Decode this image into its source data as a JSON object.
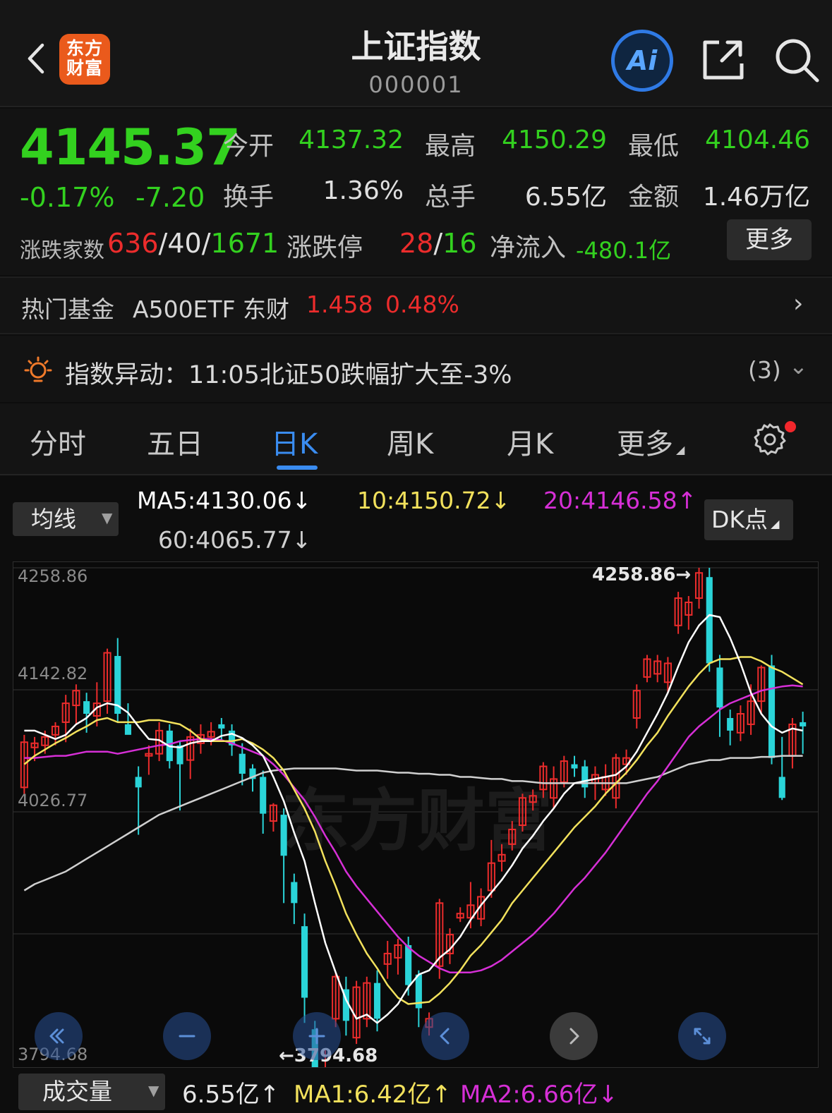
{
  "header": {
    "logo_line1": "东方",
    "logo_line2": "财富",
    "title": "上证指数",
    "code": "000001",
    "ai_label": "Ai",
    "icons": [
      "back-icon",
      "ai-icon",
      "share-icon",
      "search-icon"
    ]
  },
  "quote": {
    "price": "4145.37",
    "change_pct": "-0.17%",
    "change_val": "-7.20",
    "open_label": "今开",
    "open": "4137.32",
    "high_label": "最高",
    "high": "4150.29",
    "low_label": "最低",
    "low": "4104.46",
    "turnover_label": "换手",
    "turnover": "1.36%",
    "volume_label": "总手",
    "volume": "6.55亿",
    "amount_label": "金额",
    "amount": "1.46万亿",
    "breadth_label": "涨跌家数",
    "breadth_up": "636",
    "breadth_flat": "40",
    "breadth_down": "1671",
    "sep": "/",
    "limit_label": "涨跌停",
    "limit_up": "28",
    "limit_down": "16",
    "inflow_label": "净流入",
    "inflow": "-480.1亿",
    "more_label": "更多"
  },
  "fund": {
    "label": "热门基金",
    "name": "A500ETF 东财",
    "price": "1.458",
    "pct": "0.48%",
    "chevron": "›"
  },
  "alert": {
    "text": "指数异动：11:05北证50跌幅扩大至-3%",
    "count": "(3)",
    "chevron": "⌄"
  },
  "tabs": [
    "分时",
    "五日",
    "日K",
    "周K",
    "月K",
    "更多"
  ],
  "tab_more_marker": "◢",
  "active_tab": "日K",
  "ma": {
    "select_label": "均线",
    "select_arrow": "▼",
    "ma5": "MA5:4130.06↓",
    "ma10": "10:4150.72↓",
    "ma20": "20:4146.58↑",
    "ma60": "60:4065.77↓",
    "dk_label": "DK点",
    "dk_marker": "◢"
  },
  "colors": {
    "up": "#ec2c2c",
    "down": "#2ad4d8",
    "ma5": "#ffffff",
    "ma10": "#f2e15c",
    "ma20": "#d62fd6",
    "ma60": "#cfcfcf",
    "green": "#33d11f",
    "accent": "#3a8cf0"
  },
  "chart_data": {
    "type": "candlestick",
    "y_labels": [
      "4258.86",
      "4142.82",
      "4026.77",
      "3794.68"
    ],
    "ylim": [
      3794.68,
      4258.86
    ],
    "max_label": "4258.86→",
    "min_label": "←3794.68",
    "watermark": "东方财富",
    "candles": [
      [
        4050,
        4093,
        4044,
        4100
      ],
      [
        4088,
        4092,
        4075,
        4098
      ],
      [
        4090,
        4098,
        4082,
        4104
      ],
      [
        4100,
        4108,
        4090,
        4112
      ],
      [
        4112,
        4130,
        4093,
        4138
      ],
      [
        4128,
        4142,
        4110,
        4148
      ],
      [
        4132,
        4120,
        4102,
        4140
      ],
      [
        4118,
        4130,
        4108,
        4150
      ],
      [
        4132,
        4178,
        4120,
        4182
      ],
      [
        4175,
        4120,
        4112,
        4192
      ],
      [
        4110,
        4100,
        4102,
        4130
      ],
      [
        4060,
        4050,
        4005,
        4070
      ],
      [
        4080,
        4082,
        4062,
        4090
      ],
      [
        4082,
        4104,
        4075,
        4112
      ],
      [
        4104,
        4075,
        4068,
        4110
      ],
      [
        4090,
        4072,
        4028,
        4094
      ],
      [
        4076,
        4098,
        4058,
        4106
      ],
      [
        4092,
        4100,
        4082,
        4110
      ],
      [
        4098,
        4103,
        4090,
        4112
      ],
      [
        4110,
        4106,
        4094,
        4116
      ],
      [
        4104,
        4090,
        4080,
        4110
      ],
      [
        4082,
        4063,
        4052,
        4092
      ],
      [
        4068,
        4058,
        4046,
        4072
      ],
      [
        4060,
        4025,
        4006,
        4066
      ],
      [
        4018,
        4033,
        4008,
        4035
      ],
      [
        4024,
        3985,
        3940,
        4030
      ],
      [
        3960,
        3940,
        3920,
        3968
      ],
      [
        3918,
        3850,
        3826,
        3930
      ],
      [
        3820,
        3750,
        3738,
        3828
      ],
      [
        3730,
        3780,
        3726,
        3800
      ],
      [
        3830,
        3870,
        3822,
        3874
      ],
      [
        3858,
        3828,
        3814,
        3870
      ],
      [
        3812,
        3860,
        3806,
        3866
      ],
      [
        3830,
        3864,
        3822,
        3870
      ],
      [
        3864,
        3830,
        3818,
        3876
      ],
      [
        3882,
        3892,
        3868,
        3904
      ],
      [
        3888,
        3900,
        3872,
        3906
      ],
      [
        3900,
        3862,
        3852,
        3908
      ],
      [
        3872,
        3840,
        3822,
        3876
      ],
      [
        3822,
        3830,
        3814,
        3836
      ],
      [
        3880,
        3940,
        3868,
        3944
      ],
      [
        3892,
        3910,
        3882,
        3916
      ],
      [
        3926,
        3930,
        3922,
        3936
      ],
      [
        3926,
        3938,
        3916,
        3960
      ],
      [
        3925,
        3946,
        3918,
        3954
      ],
      [
        3952,
        3978,
        3945,
        4000
      ],
      [
        3980,
        3986,
        3970,
        3996
      ],
      [
        3996,
        4010,
        3990,
        4018
      ],
      [
        4014,
        4040,
        4008,
        4044
      ],
      [
        4036,
        4042,
        4028,
        4048
      ],
      [
        4048,
        4070,
        4040,
        4074
      ],
      [
        4040,
        4058,
        4030,
        4070
      ],
      [
        4055,
        4075,
        4050,
        4080
      ],
      [
        4072,
        4068,
        4060,
        4080
      ],
      [
        4070,
        4050,
        4040,
        4076
      ],
      [
        4054,
        4062,
        4038,
        4070
      ],
      [
        4048,
        4060,
        4042,
        4072
      ],
      [
        4040,
        4078,
        4030,
        4082
      ],
      [
        4072,
        4078,
        4062,
        4086
      ],
      [
        4116,
        4142,
        4106,
        4148
      ],
      [
        4155,
        4172,
        4150,
        4176
      ],
      [
        4158,
        4170,
        4150,
        4176
      ],
      [
        4150,
        4168,
        4140,
        4174
      ],
      [
        4204,
        4230,
        4196,
        4236
      ],
      [
        4214,
        4226,
        4200,
        4232
      ],
      [
        4230,
        4254,
        4220,
        4258.86
      ],
      [
        4250,
        4168,
        4160,
        4258.86
      ],
      [
        4164,
        4126,
        4098,
        4176
      ],
      [
        4116,
        4104,
        4090,
        4124
      ],
      [
        4102,
        4120,
        4094,
        4128
      ],
      [
        4110,
        4132,
        4100,
        4148
      ],
      [
        4132,
        4164,
        4120,
        4166
      ],
      [
        4166,
        4078,
        4072,
        4176
      ],
      [
        4060,
        4040,
        4038,
        4098
      ],
      [
        4080,
        4110,
        4068,
        4116
      ],
      [
        4112,
        4108,
        4082,
        4122
      ]
    ],
    "ma5": [
      4104,
      4104,
      4100,
      4096,
      4100,
      4110,
      4116,
      4126,
      4130,
      4128,
      4121,
      4108,
      4096,
      4095,
      4089,
      4088,
      4092,
      4094,
      4094,
      4099,
      4101,
      4097,
      4090,
      4080,
      4060,
      4037,
      4007,
      3980,
      3940,
      3902,
      3874,
      3848,
      3830,
      3834,
      3826,
      3834,
      3844,
      3860,
      3872,
      3876,
      3888,
      3896,
      3908,
      3924,
      3938,
      3950,
      3962,
      3976,
      3992,
      4004,
      4018,
      4030,
      4044,
      4054,
      4056,
      4058,
      4060,
      4062,
      4070,
      4084,
      4102,
      4120,
      4140,
      4165,
      4188,
      4204,
      4214,
      4212,
      4192,
      4168,
      4140,
      4120,
      4108,
      4102,
      4106,
      4104
    ],
    "ma10": [
      4072,
      4080,
      4086,
      4092,
      4097,
      4103,
      4108,
      4114,
      4116,
      4112,
      4112,
      4112,
      4114,
      4114,
      4112,
      4110,
      4104,
      4096,
      4094,
      4094,
      4094,
      4096,
      4092,
      4086,
      4078,
      4066,
      4048,
      4030,
      4008,
      3980,
      3956,
      3930,
      3910,
      3892,
      3878,
      3862,
      3850,
      3844,
      3845,
      3846,
      3854,
      3864,
      3876,
      3890,
      3900,
      3912,
      3924,
      3940,
      3952,
      3964,
      3976,
      3988,
      4000,
      4012,
      4022,
      4032,
      4044,
      4054,
      4064,
      4076,
      4090,
      4102,
      4118,
      4132,
      4146,
      4158,
      4168,
      4172,
      4172,
      4174,
      4174,
      4170,
      4164,
      4160,
      4154,
      4148
    ],
    "ma20": [
      4078,
      4078,
      4079,
      4080,
      4080,
      4082,
      4084,
      4084,
      4084,
      4082,
      4084,
      4086,
      4088,
      4090,
      4091,
      4094,
      4095,
      4096,
      4096,
      4095,
      4092,
      4088,
      4084,
      4080,
      4072,
      4062,
      4050,
      4038,
      4022,
      4004,
      3988,
      3970,
      3956,
      3944,
      3932,
      3920,
      3908,
      3898,
      3890,
      3884,
      3878,
      3874,
      3874,
      3874,
      3876,
      3880,
      3886,
      3894,
      3902,
      3910,
      3920,
      3930,
      3942,
      3954,
      3964,
      3976,
      3988,
      4002,
      4016,
      4030,
      4044,
      4056,
      4070,
      4084,
      4098,
      4108,
      4116,
      4124,
      4130,
      4134,
      4138,
      4142,
      4144,
      4146,
      4147,
      4146
    ],
    "ma60": [
      3952,
      3958,
      3962,
      3966,
      3970,
      3976,
      3982,
      3988,
      3994,
      4000,
      4006,
      4012,
      4018,
      4024,
      4028,
      4032,
      4036,
      4040,
      4044,
      4048,
      4052,
      4056,
      4060,
      4064,
      4066,
      4067,
      4068,
      4068,
      4068,
      4068,
      4068,
      4067,
      4066,
      4066,
      4066,
      4065,
      4064,
      4064,
      4063,
      4063,
      4062,
      4062,
      4060,
      4060,
      4059,
      4058,
      4058,
      4056,
      4056,
      4055,
      4054,
      4054,
      4054,
      4054,
      4054,
      4054,
      4054,
      4054,
      4054,
      4056,
      4058,
      4060,
      4064,
      4068,
      4072,
      4074,
      4076,
      4076,
      4078,
      4078,
      4078,
      4079,
      4079,
      4080,
      4080,
      4080
    ]
  },
  "nav_icons": [
    "double-left-icon",
    "zoom-out-icon",
    "zoom-in-icon",
    "left-icon",
    "right-icon",
    "expand-icon"
  ],
  "volume": {
    "select_label": "成交量",
    "select_arrow": "▼",
    "vol": "6.55亿↑",
    "ma1": "MA1:6.42亿↑",
    "ma2": "MA2:6.66亿↓"
  }
}
